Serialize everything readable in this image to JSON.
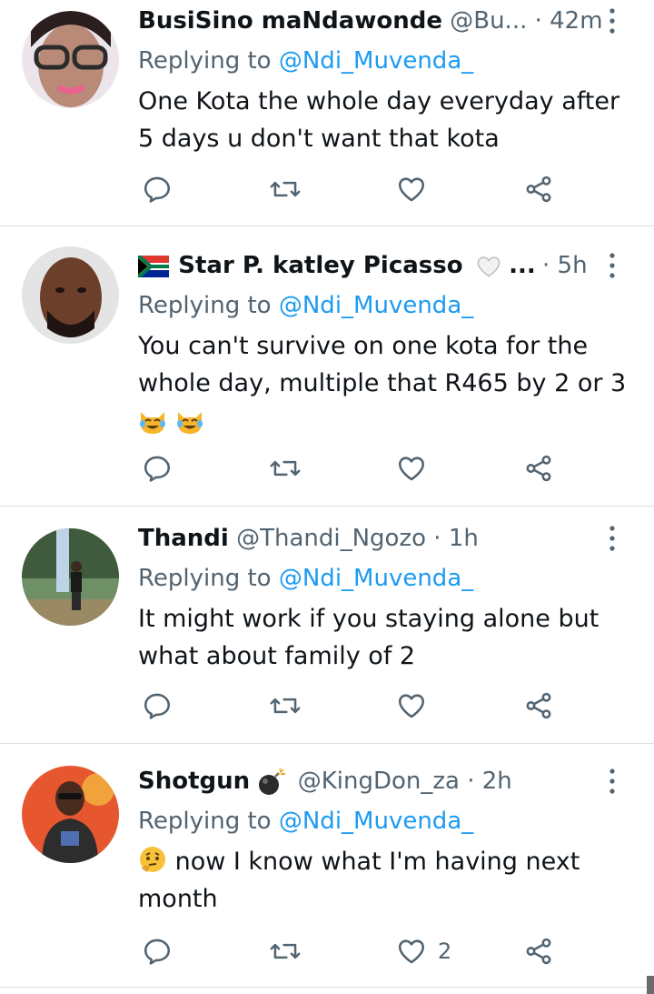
{
  "tweets": [
    {
      "name": "BusiSino maNdawonde",
      "name_suffix": "",
      "handle": "@Bu...",
      "time": "42m",
      "replying_prefix": "Replying to ",
      "replying_to": "@Ndi_Muvenda_",
      "text_lines": [
        "One Kota the whole day everyday after",
        "5 days u don't want that kota"
      ],
      "like_count": ""
    },
    {
      "name": "Star P. katley Picasso",
      "name_suffix": "...",
      "handle": "",
      "time": "5h",
      "replying_prefix": "Replying to ",
      "replying_to": "@Ndi_Muvenda_",
      "text_lines": [
        "You can't survive on one kota for the",
        "whole day, multiple that R465 by 2 or 3"
      ],
      "like_count": ""
    },
    {
      "name": "Thandi",
      "name_suffix": "",
      "handle": "@Thandi_Ngozo",
      "time": "1h",
      "replying_prefix": "Replying to ",
      "replying_to": "@Ndi_Muvenda_",
      "text_lines": [
        "It might work if you staying alone but",
        "what about family of 2"
      ],
      "like_count": ""
    },
    {
      "name": "Shotgun",
      "name_suffix": "",
      "handle": "@KingDon_za",
      "time": "2h",
      "replying_prefix": "Replying to ",
      "replying_to": "@Ndi_Muvenda_",
      "text_lines": [
        " now I know what I'm having next",
        "month"
      ],
      "like_count": "2"
    }
  ],
  "dot_separator": "·",
  "colors": {
    "link": "#1d9bf0",
    "secondary_text": "#536471",
    "primary_text": "#0f1419",
    "divider": "#d9dde1"
  },
  "icons": [
    "reply-icon",
    "retweet-icon",
    "like-icon",
    "share-icon",
    "more-icon"
  ]
}
